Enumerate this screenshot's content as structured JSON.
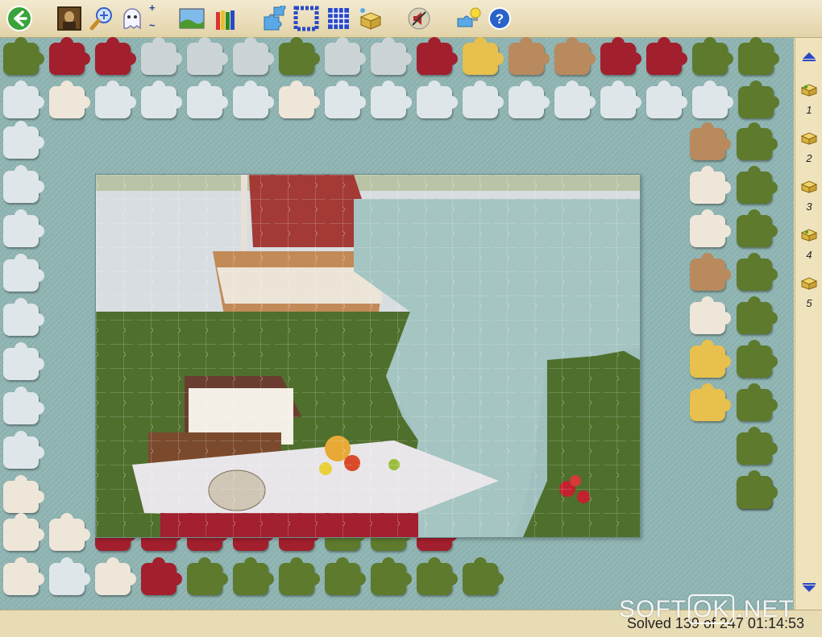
{
  "toolbar": {
    "buttons": [
      {
        "name": "back-button",
        "icon": "green-left-arrow-icon",
        "color": "#3aa33a"
      },
      {
        "name": "picture-preview-button",
        "icon": "mona-lisa-icon"
      },
      {
        "name": "zoom-in-button",
        "icon": "magnifier-plus-icon"
      },
      {
        "name": "ghost-image-button",
        "icon": "ghost-icon"
      },
      {
        "name": "landscape-button",
        "icon": "landscape-icon"
      },
      {
        "name": "pencils-button",
        "icon": "pencils-icon"
      },
      {
        "name": "shuffle-pieces-button",
        "icon": "puzzle-pieces-icon"
      },
      {
        "name": "edge-pieces-button",
        "icon": "border-grid-icon"
      },
      {
        "name": "all-pieces-grid-button",
        "icon": "grid-icon"
      },
      {
        "name": "sort-box-button",
        "icon": "box-icon"
      },
      {
        "name": "sound-button",
        "icon": "speaker-mute-icon"
      },
      {
        "name": "hint-button",
        "icon": "lightbulb-piece-icon"
      },
      {
        "name": "help-button",
        "icon": "help-icon"
      }
    ],
    "plus_label": "+",
    "minus_label": "~"
  },
  "rail": {
    "up_icon": "triangle-up-icon",
    "down_icon": "triangle-down-icon",
    "boxes": [
      {
        "label": "1",
        "icon": "box-icon"
      },
      {
        "label": "2",
        "icon": "box-icon"
      },
      {
        "label": "3",
        "icon": "box-icon"
      },
      {
        "label": "4",
        "icon": "box-icon"
      },
      {
        "label": "5",
        "icon": "box-icon"
      }
    ]
  },
  "status": {
    "text": "Solved 139 of 247    01:14:53"
  },
  "watermark": {
    "left": "SOFT",
    "middle": "OK",
    "right": ".NET"
  },
  "colors": {
    "board": "#8fb5b3",
    "panel": "#e8dcb5",
    "accent": "#3a5fc7"
  }
}
